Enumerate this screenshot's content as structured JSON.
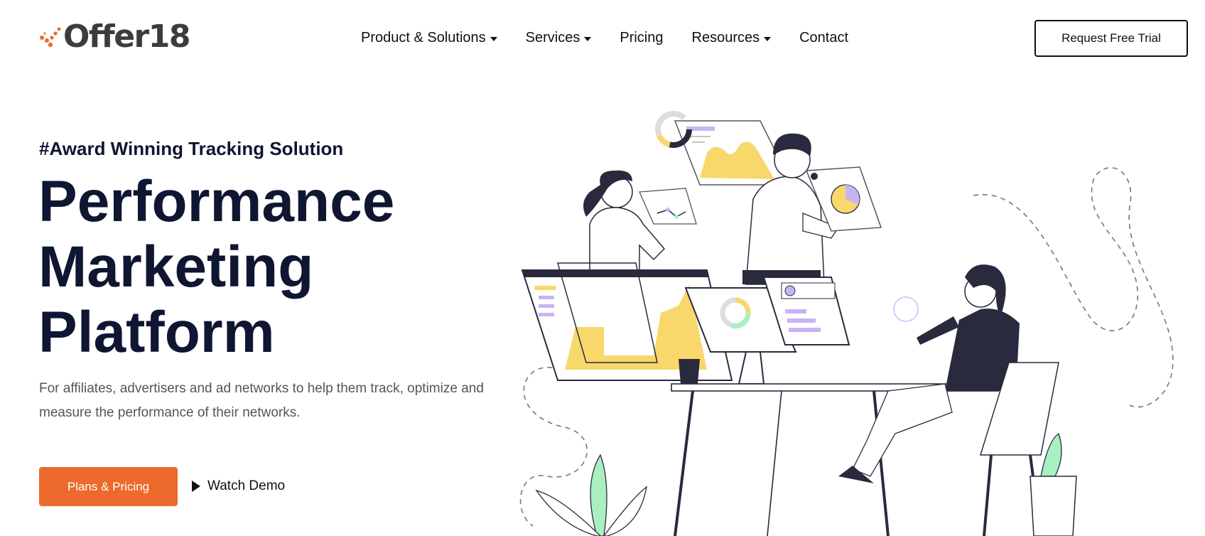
{
  "brand": {
    "name": "Offer18",
    "accent": "#ec6a2c",
    "text_color": "#3c3c3c"
  },
  "nav": {
    "items": [
      {
        "label": "Product & Solutions",
        "dropdown": true
      },
      {
        "label": "Services",
        "dropdown": true
      },
      {
        "label": "Pricing",
        "dropdown": false
      },
      {
        "label": "Resources",
        "dropdown": true
      },
      {
        "label": "Contact",
        "dropdown": false
      }
    ],
    "cta_label": "Request Free Trial"
  },
  "hero": {
    "tagline": "#Award Winning Tracking Solution",
    "title_lines": [
      "Performance",
      "Marketing",
      "Platform"
    ],
    "description": "For affiliates, advertisers and ad networks to help them track, optimize and measure the performance of their networks.",
    "primary_cta": "Plans & Pricing",
    "secondary_cta": "Watch Demo"
  },
  "colors": {
    "heading": "#0f1632",
    "body_text": "#555555",
    "illustration_yellow": "#f8d86a",
    "illustration_purple": "#c8b3f5",
    "illustration_green": "#a8f0c0",
    "illustration_navy": "#2a2a3e"
  },
  "icons": [
    "logo-check-icon",
    "caret-down-icon",
    "play-icon"
  ]
}
